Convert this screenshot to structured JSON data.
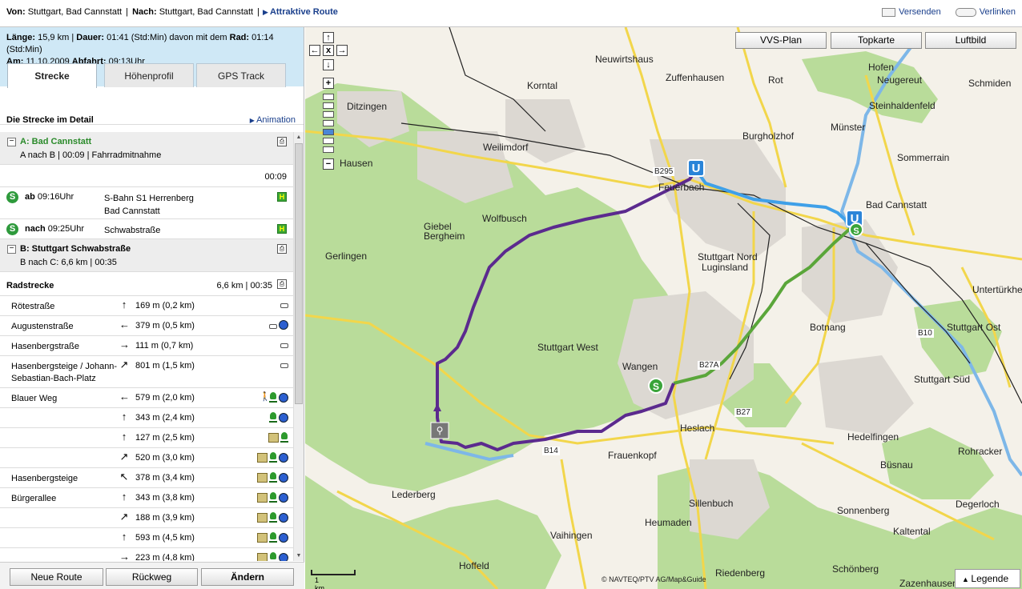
{
  "header": {
    "von_label": "Von:",
    "von_value": "Stuttgart, Bad Cannstatt",
    "nach_label": "Nach:",
    "nach_value": "Stuttgart, Bad Cannstatt",
    "route_type": "Attraktive Route",
    "send_label": "Versenden",
    "link_label": "Verlinken"
  },
  "summary": {
    "laenge_label": "Länge:",
    "laenge": "15,9 km",
    "dauer_label": "Dauer:",
    "dauer": "01:41 (Std:Min) davon mit dem",
    "rad_label": "Rad:",
    "rad": "01:14 (Std:Min)",
    "am_label": "Am:",
    "am": "11.10.2009",
    "abfahrt_label": "Abfahrt:",
    "abfahrt": "09:13Uhr"
  },
  "tabs": [
    "Strecke",
    "Höhenprofil",
    "GPS Track"
  ],
  "detail": {
    "title": "Die Strecke im Detail",
    "animation": "Animation"
  },
  "section_a": {
    "title": "A: Bad Cannstatt",
    "sub": "A nach B | 00:09 | Fahrradmitnahme",
    "time": "00:09"
  },
  "transit": [
    {
      "dir": "ab",
      "time": "09:16Uhr",
      "line1": "S-Bahn S1 Herrenberg",
      "line2": "Bad Cannstatt"
    },
    {
      "dir": "nach",
      "time": "09:25Uhr",
      "line1": "Schwabstraße",
      "line2": ""
    }
  ],
  "section_b": {
    "title": "B: Stuttgart Schwabstraße",
    "sub": "B nach C: 6,6 km | 00:35"
  },
  "radstrecke": {
    "title": "Radstrecke",
    "summary": "6,6 km | 00:35"
  },
  "segments": [
    {
      "street": "Rötestraße",
      "dir": "↑",
      "dist": "169 m (0,2 km)",
      "icons": [
        "car"
      ]
    },
    {
      "street": "Augustenstraße",
      "dir": "←",
      "dist": "379 m (0,5 km)",
      "icons": [
        "car",
        "blue"
      ]
    },
    {
      "street": "Hasenbergstraße",
      "dir": "→",
      "dist": "111 m (0,7 km)",
      "icons": [
        "car"
      ]
    },
    {
      "street": "Hasenbergsteige / Johann-Sebastian-Bach-Platz",
      "dir": "↗",
      "dist": "801 m (1,5 km)",
      "icons": [
        "car"
      ]
    },
    {
      "street": "Blauer Weg",
      "dir": "←",
      "dist": "579 m (2,0 km)",
      "icons": [
        "walk",
        "tree",
        "blue"
      ]
    },
    {
      "street": "",
      "dir": "↑",
      "dist": "343 m (2,4 km)",
      "icons": [
        "tree",
        "blue"
      ]
    },
    {
      "street": "",
      "dir": "↑",
      "dist": "127 m (2,5 km)",
      "icons": [
        "book",
        "tree"
      ]
    },
    {
      "street": "",
      "dir": "↗",
      "dist": "520 m (3,0 km)",
      "icons": [
        "book",
        "tree",
        "blue"
      ]
    },
    {
      "street": "Hasenbergsteige",
      "dir": "↖",
      "dist": "378 m (3,4 km)",
      "icons": [
        "book",
        "tree",
        "blue"
      ]
    },
    {
      "street": "Bürgerallee",
      "dir": "↑",
      "dist": "343 m (3,8 km)",
      "icons": [
        "book",
        "tree",
        "blue"
      ]
    },
    {
      "street": "",
      "dir": "↗",
      "dist": "188 m (3,9 km)",
      "icons": [
        "book",
        "tree",
        "blue"
      ]
    },
    {
      "street": "",
      "dir": "↑",
      "dist": "593 m (4,5 km)",
      "icons": [
        "book",
        "tree",
        "blue"
      ]
    },
    {
      "street": "",
      "dir": "→",
      "dist": "223 m (4,8 km)",
      "icons": [
        "book",
        "tree",
        "blue"
      ]
    }
  ],
  "buttons": {
    "new_route": "Neue Route",
    "back": "Rückweg",
    "change": "Ändern"
  },
  "map": {
    "buttons": [
      "VVS-Plan",
      "Topkarte",
      "Luftbild"
    ],
    "zoom_in": "+",
    "zoom_out": "−",
    "labels": [
      "Neuwirtshaus",
      "Zuffenhausen",
      "Rot",
      "Hofen",
      "Neugereut",
      "Korntal",
      "Steinhaldenfeld",
      "Ditzingen",
      "Münster",
      "Burgholzhof",
      "Weilimdorf",
      "Sommerrain",
      "Hausen",
      "Feuerbach",
      "Bad Cannstatt",
      "Wolfbusch",
      "Giebel",
      "Bergheim",
      "Gerlingen",
      "Stuttgart Nord",
      "Luginsland",
      "Untertürkheim",
      "Stuttgart Ost",
      "Botnang",
      "Stuttgart West",
      "Wangen",
      "Stuttgart Süd",
      "Heslach",
      "Frauenkopf",
      "Hedelfingen",
      "Rohracker",
      "Büsnau",
      "Lederberg",
      "Degerloch",
      "Sillenbuch",
      "Sonnenberg",
      "Heumaden",
      "Kaltental",
      "Vaihingen",
      "Hoffeld",
      "Riedenberg",
      "Schönberg",
      "Zazenhausen",
      "Schmiden"
    ],
    "roads": [
      "B295",
      "B10",
      "B14",
      "B27",
      "B27A"
    ],
    "scale": "1 km",
    "copyright": "© NAVTEQ/PTV AG/Map&Guide",
    "legend": "Legende"
  },
  "colors": {
    "route_bike": "#5b2a8e",
    "route_ubahn": "#3fa0e8",
    "route_sbahn": "#5aa63a",
    "info_bg": "#cfe8f6"
  }
}
